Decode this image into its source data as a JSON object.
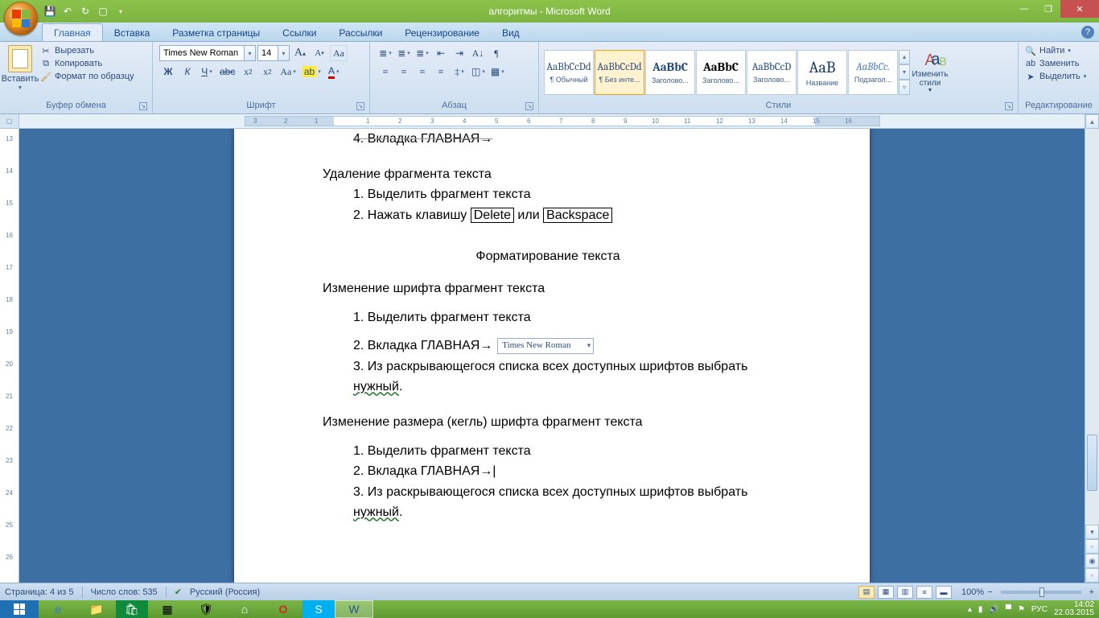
{
  "title": "алгоритмы - Microsoft Word",
  "tabs": [
    "Главная",
    "Вставка",
    "Разметка страницы",
    "Ссылки",
    "Рассылки",
    "Рецензирование",
    "Вид"
  ],
  "active_tab": 0,
  "clipboard": {
    "paste": "Вставить",
    "cut": "Вырезать",
    "copy": "Копировать",
    "format_painter": "Формат по образцу",
    "label": "Буфер обмена"
  },
  "font": {
    "name": "Times New Roman",
    "size": "14",
    "grow": "A",
    "shrink": "A",
    "clear": "Aa",
    "label": "Шрифт",
    "bold": "Ж",
    "italic": "К",
    "underline": "Ч",
    "strike": "abc",
    "sub": "x₂",
    "sup": "x²",
    "case": "Aa",
    "highlight": "aᵇ",
    "color": "A"
  },
  "paragraph": {
    "label": "Абзац"
  },
  "styles": {
    "label": "Стили",
    "change": "Изменить стили",
    "items": [
      {
        "preview": "AaBbCcDd",
        "name": "¶ Обычный",
        "color": "#000"
      },
      {
        "preview": "AaBbCcDd",
        "name": "¶ Без инте...",
        "color": "#000",
        "selected": true
      },
      {
        "preview": "AaBbC",
        "name": "Заголово...",
        "color": "#1f497d",
        "bold": true
      },
      {
        "preview": "AaBbC",
        "name": "Заголово...",
        "color": "#1f497d",
        "bold": true
      },
      {
        "preview": "AaBbCcD",
        "name": "Заголово...",
        "color": "#1f497d"
      },
      {
        "preview": "AaB",
        "name": "Название",
        "color": "#17365d",
        "size": "20px"
      },
      {
        "preview": "AaBbCc.",
        "name": "Подзагол...",
        "color": "#4f81bd",
        "italic": true
      }
    ]
  },
  "editing": {
    "find": "Найти",
    "replace": "Заменить",
    "select": "Выделить",
    "label": "Редактирование"
  },
  "document": {
    "line0": "4.  Вкладка ГЛАВНАЯ→",
    "h1": "Удаление фрагмента текста",
    "l1": "1.  Выделить фрагмент текста",
    "l2a": "2.  Нажать клавишу ",
    "l2b": "Delete",
    "l2c": " или  ",
    "l2d": "Backspace",
    "center": "Форматирование текста",
    "h2": "Изменение шрифта фрагмент текста",
    "s2_1": "1.  Выделить фрагмент текста",
    "s2_2": "2.  Вкладка ГЛАВНАЯ→",
    "s2_combo": "Times New Roman",
    "s2_3a": "3.  Из раскрывающегося списка всех доступных шрифтов выбрать ",
    "s2_3b": "нужный",
    "s2_3c": ".",
    "h3": "Изменение размера (кегль) шрифта фрагмент текста",
    "s3_1": "1.  Выделить фрагмент текста",
    "s3_2": "2.  Вкладка ГЛАВНАЯ→|",
    "s3_3a": "3.  Из раскрывающегося списка всех доступных шрифтов выбрать ",
    "s3_3b": "нужный",
    "s3_3c": "."
  },
  "status": {
    "page": "Страница: 4 из 5",
    "words": "Число слов: 535",
    "lang": "Русский (Россия)",
    "zoom": "100%"
  },
  "tray": {
    "lang": "РУС",
    "time": "14:02",
    "date": "22.03.2015"
  }
}
